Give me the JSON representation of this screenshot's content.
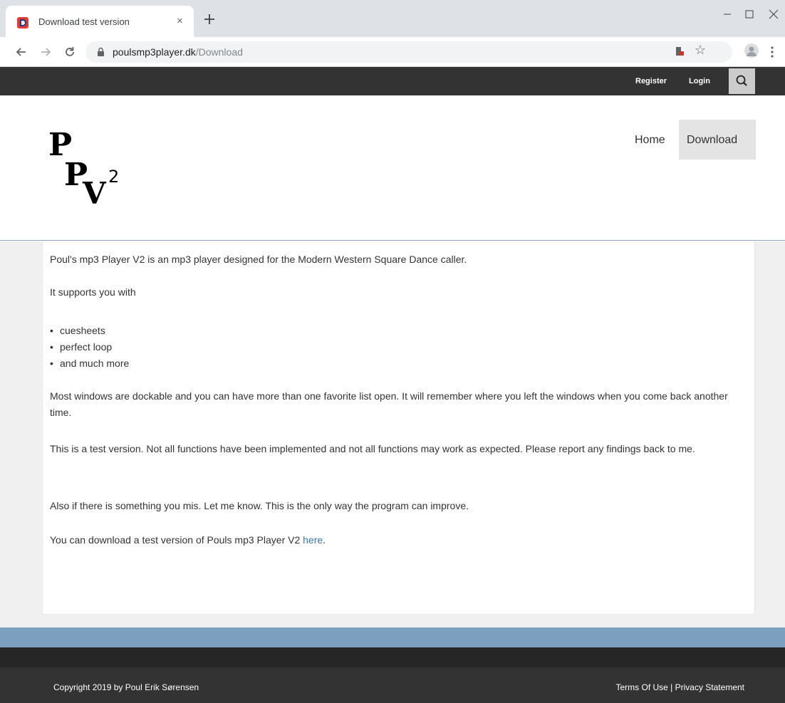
{
  "browser": {
    "tab_title": "Download test version",
    "tab_close": "×",
    "url_host": "poulsmp3player.dk",
    "url_path": "/Download",
    "star": "☆"
  },
  "topbar": {
    "register": "Register",
    "login": "Login"
  },
  "header": {
    "logo_text": "PPV2",
    "nav": {
      "home": "Home",
      "download": "Download"
    }
  },
  "content": {
    "intro": "Poul's mp3 Player V2 is an mp3 player designed for the Modern Western Square Dance caller.",
    "supports": "It supports you with",
    "features": [
      "cuesheets",
      "perfect loop",
      "and much more"
    ],
    "dockable": "Most windows are dockable and you can have more than one favorite list open. It will remember where you left the windows when you come back another time.",
    "test_version": "This is a test version. Not all functions have been implemented and not all functions may work as expected. Please report any findings back to me.",
    "mis": "Also if there is something you mis. Let me know. This is the only way the program can improve.",
    "download_text": "You can download a test version of Pouls mp3 Player V2 ",
    "download_link": "here",
    "download_end": "."
  },
  "footer": {
    "copyright": "Copyright 2019 by Poul Erik Sørensen",
    "terms": "Terms Of Use",
    "separator": " | ",
    "privacy": "Privacy Statement"
  },
  "colors": {
    "topbar": "#333333",
    "footer_accent": "#7c9fc0",
    "link": "#337ab7"
  }
}
